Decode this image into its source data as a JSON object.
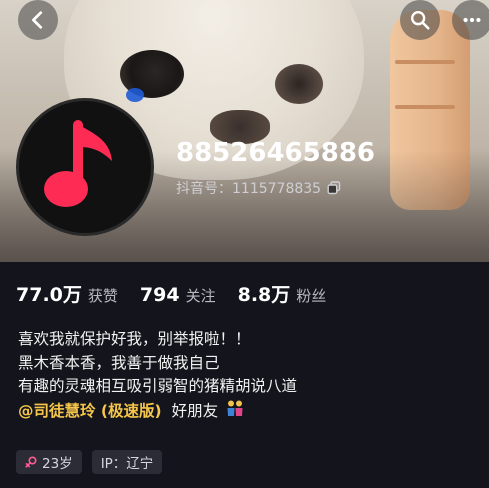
{
  "header": {
    "back_icon": "chevron-left-icon",
    "search_icon": "search-icon",
    "more_icon": "more-icon"
  },
  "profile": {
    "avatar_icon": "music-note-icon",
    "avatar_color": "#fe2c55",
    "nickname": "88526465886",
    "account_line": "抖音号：1115778835"
  },
  "stats": [
    {
      "value": "77.0万",
      "label": "获赞"
    },
    {
      "value": "794",
      "label": "关注"
    },
    {
      "value": "8.8万",
      "label": "粉丝"
    }
  ],
  "bio": {
    "line1": "喜欢我就保护好我，别举报啦！！",
    "line2": "黑木香本香，我善于做我自己",
    "line3": "有趣的灵魂相互吸引弱智的猪精胡说八道",
    "mention": "@司徒慧玲 (极速版)",
    "friend_text": "好朋友",
    "mention_color": "#f5c64b"
  },
  "tags": {
    "age": "23岁",
    "ip": "IP：辽宁"
  }
}
